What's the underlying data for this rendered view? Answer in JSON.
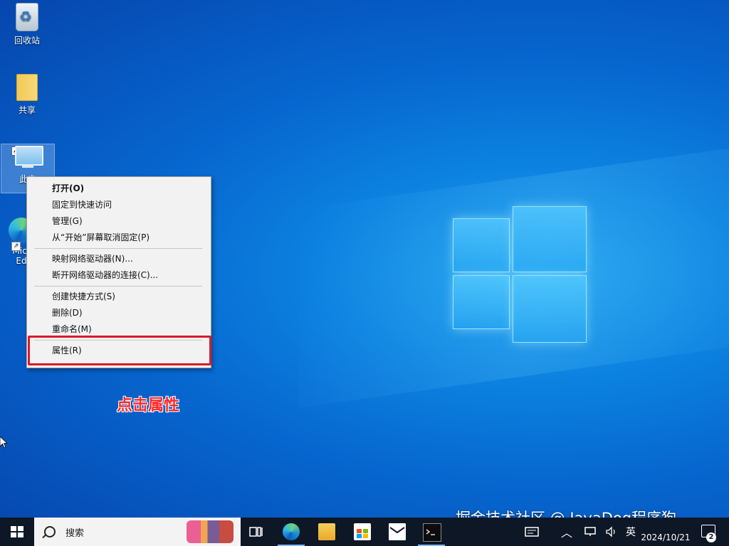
{
  "desktop": {
    "icons": [
      {
        "label": "回收站",
        "icon": "recycle-bin-icon"
      },
      {
        "label": "共享",
        "icon": "folder-icon"
      },
      {
        "label": "此电",
        "icon": "this-pc-icon"
      },
      {
        "label": "Micr",
        "label2": "Ed",
        "icon": "edge-icon"
      }
    ]
  },
  "context_menu": {
    "items": [
      {
        "label": "打开(O)",
        "bold": true
      },
      {
        "label": "固定到快速访问"
      },
      {
        "label": "管理(G)"
      },
      {
        "label": "从“开始”屏幕取消固定(P)"
      },
      {
        "label": "映射网络驱动器(N)..."
      },
      {
        "label": "断开网络驱动器的连接(C)..."
      },
      {
        "label": "创建快捷方式(S)"
      },
      {
        "label": "删除(D)"
      },
      {
        "label": "重命名(M)"
      },
      {
        "label": "属性(R)"
      }
    ]
  },
  "annotation": {
    "text": "点击属性",
    "color": "#ff2a2a",
    "highlight_color": "#e0182a"
  },
  "taskbar": {
    "search_placeholder": "搜索",
    "apps": [
      {
        "name": "task-view-icon"
      },
      {
        "name": "edge-icon"
      },
      {
        "name": "file-explorer-icon"
      },
      {
        "name": "microsoft-store-icon"
      },
      {
        "name": "mail-icon"
      },
      {
        "name": "command-prompt-icon"
      }
    ],
    "tray": {
      "chevron": "︿",
      "ime": "英",
      "date": "2024/10/21",
      "notification_count": "2"
    }
  },
  "watermark": "掘金技术社区 @ JavaDog程序狗",
  "colors": {
    "taskbar_bg": "#0e1726",
    "menu_bg": "#f2f2f2",
    "accent": "#0a78d7"
  }
}
